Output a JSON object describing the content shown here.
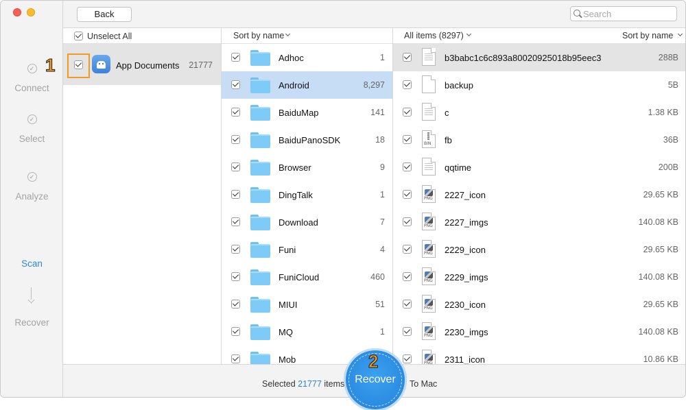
{
  "steps": [
    {
      "label": "Connect",
      "state": "done"
    },
    {
      "label": "Select",
      "state": "done"
    },
    {
      "label": "Analyze",
      "state": "done"
    },
    {
      "label": "Scan",
      "state": "active"
    },
    {
      "label": "Recover",
      "state": "pending"
    }
  ],
  "toolbar": {
    "back_label": "Back",
    "search_placeholder": "Search"
  },
  "categories_pane": {
    "header_label": "Unselect All",
    "items": [
      {
        "name": "App Documents",
        "count": "21777",
        "checked": true
      }
    ]
  },
  "folders_pane": {
    "sort_label": "Sort by name",
    "items": [
      {
        "name": "Adhoc",
        "count": "1"
      },
      {
        "name": "Android",
        "count": "8,297"
      },
      {
        "name": "BaiduMap",
        "count": "141"
      },
      {
        "name": "BaiduPanoSDK",
        "count": "18"
      },
      {
        "name": "Browser",
        "count": "9"
      },
      {
        "name": "DingTalk",
        "count": "1"
      },
      {
        "name": "Download",
        "count": "7"
      },
      {
        "name": "Funi",
        "count": "4"
      },
      {
        "name": "FuniCloud",
        "count": "460"
      },
      {
        "name": "MIUI",
        "count": "51"
      },
      {
        "name": "MQ",
        "count": "1"
      },
      {
        "name": "Mob",
        "count": ""
      }
    ]
  },
  "files_pane": {
    "all_items_label": "All items (8297)",
    "sort_label": "Sort by name",
    "items": [
      {
        "name": "b3babc1c6c893a80020925018b95eec3",
        "size": "288B",
        "icon": "text-file-icon"
      },
      {
        "name": "backup",
        "size": "5B",
        "icon": "blank-file-icon"
      },
      {
        "name": "c",
        "size": "1.38 KB",
        "icon": "text-file-icon"
      },
      {
        "name": "fb",
        "size": "36B",
        "icon": "bin-file-icon"
      },
      {
        "name": "qqtime",
        "size": "200B",
        "icon": "text-file-icon"
      },
      {
        "name": "2227_icon",
        "size": "29.65 KB",
        "icon": "png-file-icon"
      },
      {
        "name": "2227_imgs",
        "size": "140.08 KB",
        "icon": "png-file-icon"
      },
      {
        "name": "2229_icon",
        "size": "29.65 KB",
        "icon": "png-file-icon"
      },
      {
        "name": "2229_imgs",
        "size": "140.08 KB",
        "icon": "png-file-icon"
      },
      {
        "name": "2230_icon",
        "size": "29.65 KB",
        "icon": "png-file-icon"
      },
      {
        "name": "2230_imgs",
        "size": "140.08 KB",
        "icon": "png-file-icon"
      },
      {
        "name": "2311_icon",
        "size": "10.86 KB",
        "icon": "png-file-icon"
      }
    ]
  },
  "bottom": {
    "selected_prefix": "Selected",
    "selected_count": "21777",
    "selected_suffix": "items",
    "recover_label": "Recover",
    "to_mac": "To Mac"
  },
  "annotations": {
    "badge1": "1",
    "badge2": "2"
  },
  "colors": {
    "accent": "#2f86d6",
    "highlight": "#f39a1f",
    "selection": "#c7ddf6"
  }
}
